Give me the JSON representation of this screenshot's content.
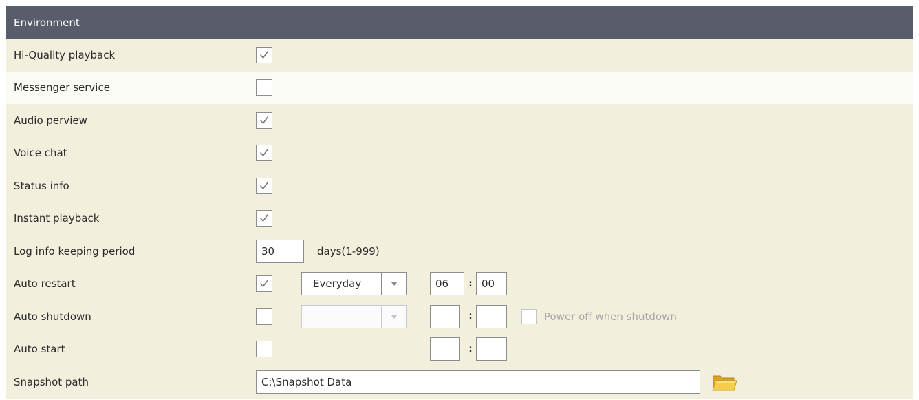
{
  "header": {
    "title": "Environment"
  },
  "rows": {
    "hi_quality": {
      "label": "Hi-Quality playback",
      "checked": true
    },
    "messenger": {
      "label": "Messenger service",
      "checked": false
    },
    "audio_preview": {
      "label": "Audio perview",
      "checked": true
    },
    "voice_chat": {
      "label": "Voice chat",
      "checked": true
    },
    "status_info": {
      "label": "Status info",
      "checked": true
    },
    "instant_playback": {
      "label": "Instant playback",
      "checked": true
    },
    "log_period": {
      "label": "Log info keeping period",
      "value": "30",
      "unit": "days(1-999)"
    },
    "auto_restart": {
      "label": "Auto restart",
      "checked": true,
      "schedule": "Everyday",
      "hour": "06",
      "minute": "00",
      "colon": ":"
    },
    "auto_shutdown": {
      "label": "Auto shutdown",
      "checked": false,
      "schedule": "",
      "hour": "",
      "minute": "",
      "colon": ":",
      "power_off_label": "Power off when shutdown",
      "power_off_checked": false
    },
    "auto_start": {
      "label": "Auto start",
      "checked": false,
      "hour": "",
      "minute": "",
      "colon": ":"
    },
    "snapshot_path": {
      "label": "Snapshot path",
      "value": "C:\\Snapshot Data"
    }
  },
  "icons": {
    "checkmark": "checkmark-icon",
    "dropdown": "chevron-down-icon",
    "folder": "folder-icon"
  },
  "colors": {
    "header_bg": "#585c6b",
    "row_alt": "#f2efdd",
    "row_plain": "#fbfbf6"
  }
}
